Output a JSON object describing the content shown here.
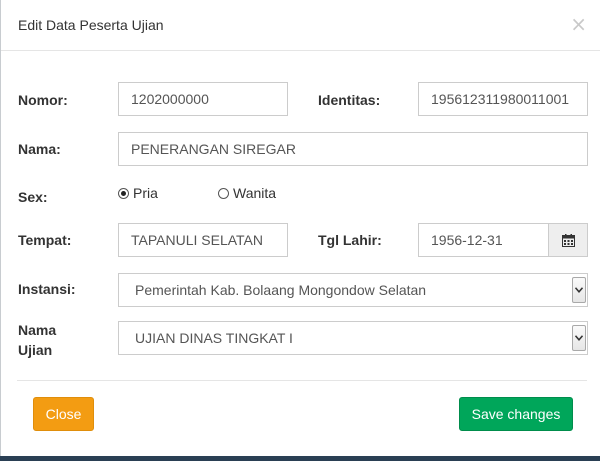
{
  "modal": {
    "title": "Edit Data Peserta Ujian",
    "close_symbol": "×"
  },
  "form": {
    "nomor_label": "Nomor:",
    "nomor_value": "1202000000",
    "identitas_label": "Identitas:",
    "identitas_value": "195612311980011001",
    "nama_label": "Nama:",
    "nama_value": "PENERANGAN SIREGAR",
    "sex_label": "Sex:",
    "sex_options": [
      "Pria",
      "Wanita"
    ],
    "sex_selected": "Pria",
    "tempat_label": "Tempat:",
    "tempat_value": "TAPANULI SELATAN",
    "tgl_lahir_label": "Tgl Lahir:",
    "tgl_lahir_value": "1956-12-31",
    "instansi_label": "Instansi:",
    "instansi_value": "Pemerintah Kab. Bolaang Mongondow Selatan",
    "nama_ujian_label_line1": "Nama",
    "nama_ujian_label_line2": "Ujian",
    "nama_ujian_value": "UJIAN DINAS TINGKAT I"
  },
  "footer": {
    "close_label": "Close",
    "save_label": "Save changes"
  },
  "colors": {
    "close_button": "#f39c12",
    "save_button": "#00a65a",
    "backdrop": "#2a3f54"
  },
  "icons": {
    "date_addon": "calendar-icon",
    "select_arrow": "chevron-down-icon",
    "close": "close-icon"
  }
}
